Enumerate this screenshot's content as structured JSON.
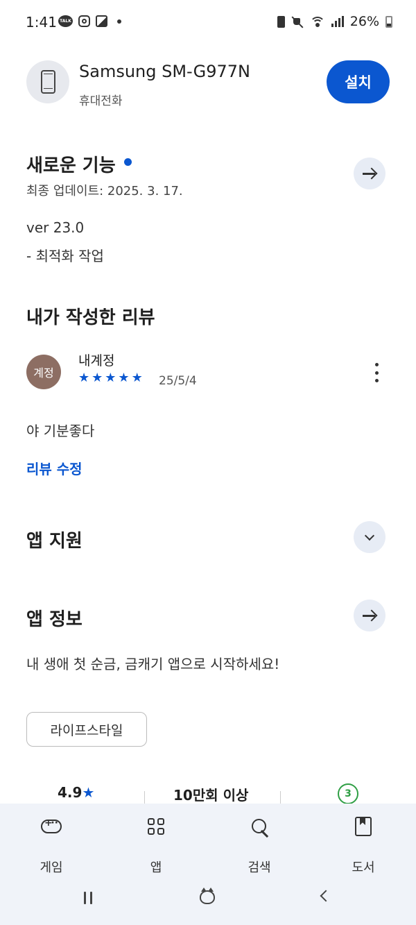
{
  "status_bar": {
    "time": "1:41",
    "talk_badge": "TALK",
    "battery_percent": "26%"
  },
  "app_header": {
    "device_name": "Samsung SM-G977N",
    "device_type": "휴대전화",
    "install_label": "설치"
  },
  "whats_new": {
    "title": "새로운 기능",
    "last_updated": "최종 업데이트: 2025. 3. 17.",
    "version": "ver 23.0",
    "notes": "- 최적화 작업"
  },
  "my_review": {
    "title": "내가 작성한 리뷰",
    "avatar_text": "계정",
    "reviewer_name": "내계정",
    "stars": [
      "★",
      "★",
      "★",
      "★",
      "★"
    ],
    "rating": 5,
    "date": "25/5/4",
    "text": "야 기분좋다",
    "edit_label": "리뷰 수정"
  },
  "app_support": {
    "title": "앱 지원"
  },
  "app_info": {
    "title": "앱 정보",
    "description": "내 생애 첫 순금, 금캐기 앱으로 시작하세요!",
    "category_chip": "라이프스타일"
  },
  "stats": {
    "rating": "4.9",
    "rating_star": "★",
    "downloads": "10만회 이상",
    "content_rating": "3"
  },
  "bottom_nav": {
    "items": [
      {
        "label": "게임",
        "icon": "gamepad-icon"
      },
      {
        "label": "앱",
        "icon": "apps-grid-icon"
      },
      {
        "label": "검색",
        "icon": "search-icon"
      },
      {
        "label": "도서",
        "icon": "book-icon"
      }
    ]
  },
  "colors": {
    "accent": "#0b57d0",
    "avatar": "#8d6e63",
    "content_rating_badge": "#2e9e44",
    "nav_background": "#f0f3f9"
  }
}
